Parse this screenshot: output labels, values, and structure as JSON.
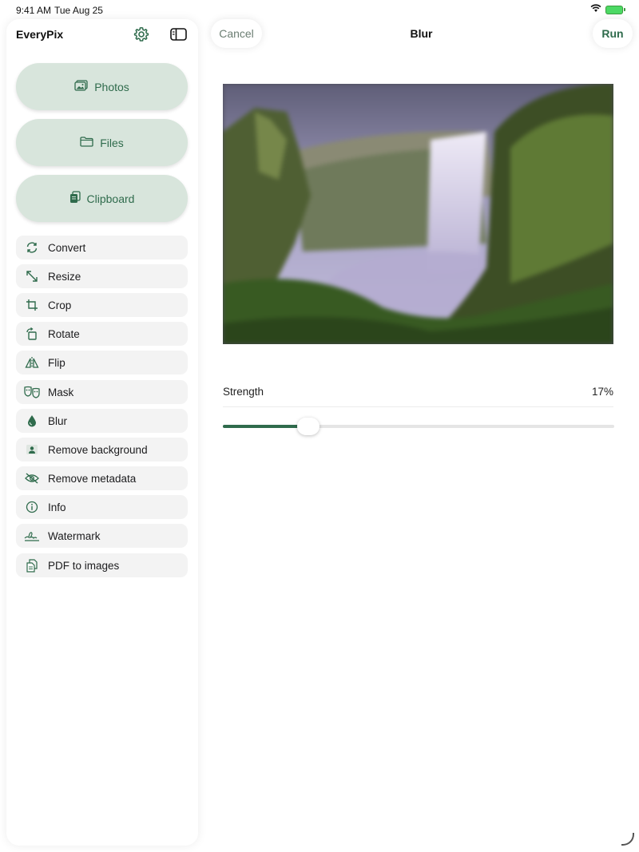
{
  "status_bar": {
    "time": "9:41 AM",
    "date": "Tue Aug 25"
  },
  "sidebar": {
    "title": "EveryPix",
    "sources": [
      {
        "label": "Photos",
        "icon": "photo-icon"
      },
      {
        "label": "Files",
        "icon": "folder-icon"
      },
      {
        "label": "Clipboard",
        "icon": "clipboard-icon"
      }
    ],
    "tools": [
      {
        "label": "Convert",
        "icon": "convert-icon"
      },
      {
        "label": "Resize",
        "icon": "resize-icon"
      },
      {
        "label": "Crop",
        "icon": "crop-icon"
      },
      {
        "label": "Rotate",
        "icon": "rotate-icon"
      },
      {
        "label": "Flip",
        "icon": "flip-icon"
      },
      {
        "label": "Mask",
        "icon": "mask-icon"
      },
      {
        "label": "Blur",
        "icon": "blur-drop-icon"
      },
      {
        "label": "Remove background",
        "icon": "person-icon"
      },
      {
        "label": "Remove metadata",
        "icon": "eye-slash-icon"
      },
      {
        "label": "Info",
        "icon": "info-icon"
      },
      {
        "label": "Watermark",
        "icon": "signature-icon"
      },
      {
        "label": "PDF to images",
        "icon": "document-icon"
      }
    ]
  },
  "toolbar": {
    "cancel_label": "Cancel",
    "title": "Blur",
    "run_label": "Run"
  },
  "blur": {
    "strength_label": "Strength",
    "strength_value": "17%",
    "strength_fraction": 0.17
  },
  "colors": {
    "accent": "#2f6b4c",
    "button_fill": "#d8e5dc"
  }
}
